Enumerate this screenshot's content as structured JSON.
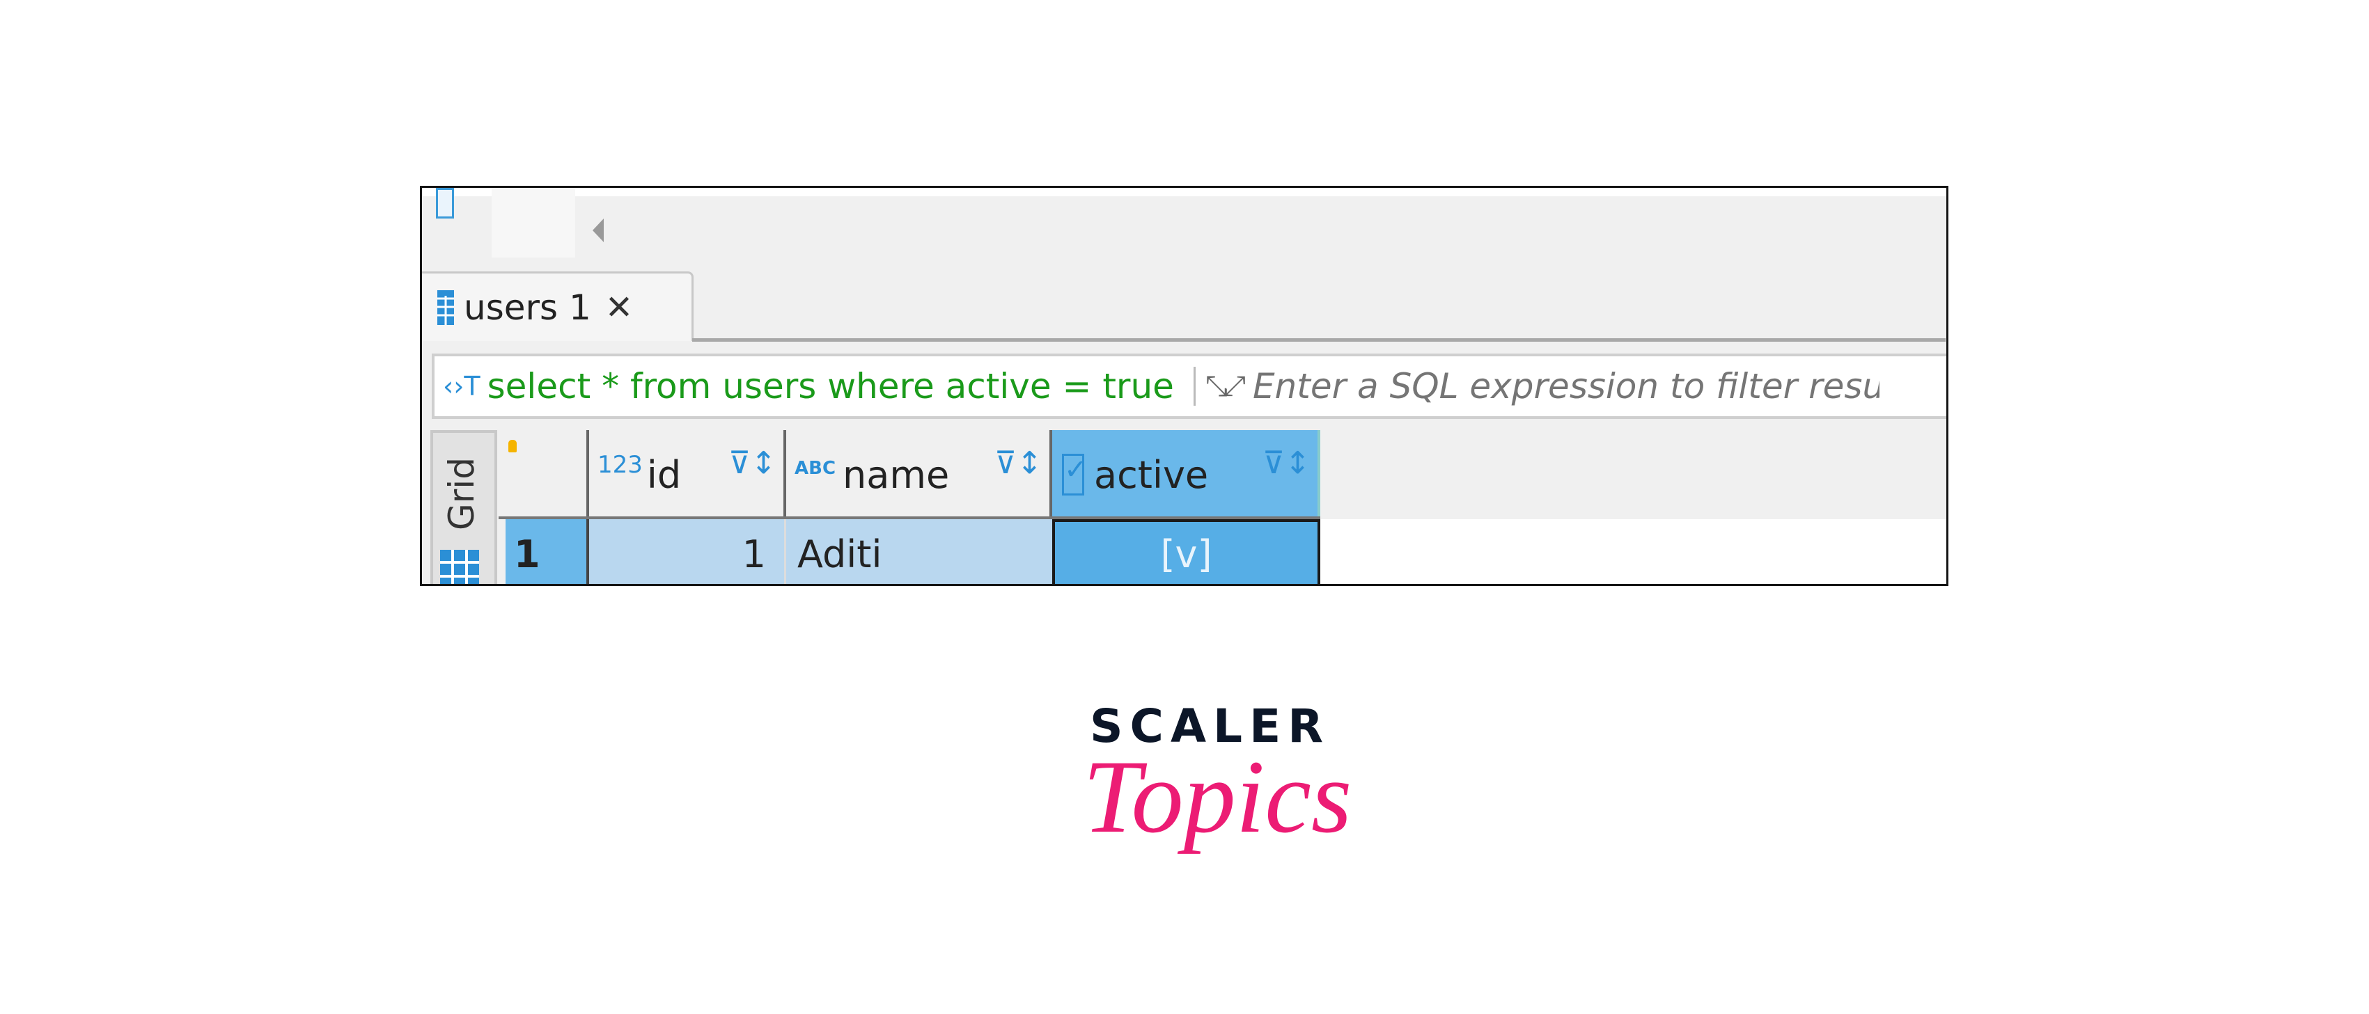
{
  "tab": {
    "icon": "table-icon",
    "label": "users 1",
    "close_icon": "close-icon"
  },
  "filter": {
    "query": "select * from users where active = true",
    "placeholder": "Enter a SQL expression to filter resu"
  },
  "grid": {
    "side_tab_label": "Grid",
    "columns": [
      {
        "type_badge": "123",
        "label": "id"
      },
      {
        "type_badge": "ABC",
        "label": "name"
      },
      {
        "type_badge": "checkbox",
        "label": "active"
      }
    ],
    "rows": [
      {
        "row_number": "1",
        "id": "1",
        "name": "Aditi",
        "active": "[v]"
      }
    ]
  },
  "logo": {
    "line1": "SCALER",
    "line2": "Topics"
  },
  "colors": {
    "selected_header": "#6ab8ea",
    "selected_cell": "#56aee6",
    "row_highlight": "#b9d7ef",
    "query_text": "#1a9a1a",
    "brand_pink": "#ec1c74",
    "brand_dark": "#0c1628"
  }
}
